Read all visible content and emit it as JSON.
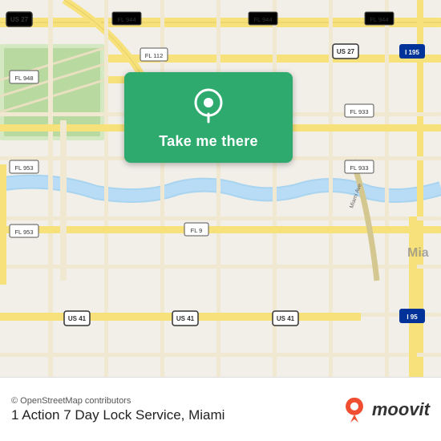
{
  "map": {
    "attribution": "© OpenStreetMap contributors",
    "background_color": "#f2efe9"
  },
  "button": {
    "label": "Take me there",
    "background_color": "#2eaa6e",
    "icon": "location-pin-icon"
  },
  "bottom_bar": {
    "attribution": "© OpenStreetMap contributors",
    "location_name": "1 Action 7 Day Lock Service, Miami",
    "moovit_text": "moovit"
  }
}
